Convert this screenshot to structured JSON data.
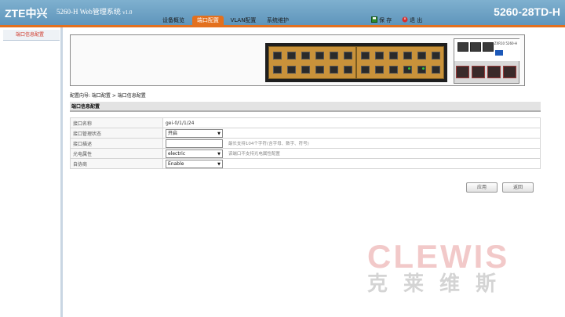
{
  "header": {
    "logo": "ZTE中兴",
    "app_title": "5260-H Web管理系统",
    "version": "v1.0",
    "device_name": "5260-28TD-H",
    "tabs": [
      {
        "label": "设备概览",
        "active": false
      },
      {
        "label": "端口配置",
        "active": true
      },
      {
        "label": "VLAN配置",
        "active": false
      },
      {
        "label": "系统维护",
        "active": false
      }
    ],
    "save_label": "保 存",
    "logout_label": "退 出",
    "accent_color": "#e3701e",
    "header_color": "#6fa3c5"
  },
  "sidebar": {
    "items": [
      {
        "label": "端口信息配置",
        "active": true
      }
    ]
  },
  "panel": {
    "brand_text": "ZXR10 5260-H",
    "port_states": [
      [
        "down",
        "down",
        "down",
        "down",
        "down",
        "down"
      ],
      [
        "down",
        "down",
        "down",
        "down",
        "down",
        "down"
      ],
      [
        "down",
        "down",
        "down",
        "down",
        "down",
        "down"
      ],
      [
        "down",
        "down",
        "down",
        "up",
        "up",
        "down"
      ]
    ]
  },
  "breadcrumb": "配置向导: 端口配置 > 端口信息配置",
  "section_title": "端口信息配置",
  "form": {
    "rows": [
      {
        "label": "接口名称",
        "value": "gei-0/1/1/24"
      },
      {
        "label": "接口管理状态",
        "value": "开启"
      },
      {
        "label": "接口描述",
        "value": "",
        "hint": "最长支持104个字符(含字母、数字、符号)"
      },
      {
        "label": "光电属性",
        "value": "electric",
        "hint": "该端口不支持光电属性配置"
      },
      {
        "label": "自协商",
        "value": "Enable"
      }
    ]
  },
  "buttons": {
    "apply": "应用",
    "back": "返回"
  },
  "watermark": {
    "en": "CLEWIS",
    "zh": "克莱维斯"
  }
}
